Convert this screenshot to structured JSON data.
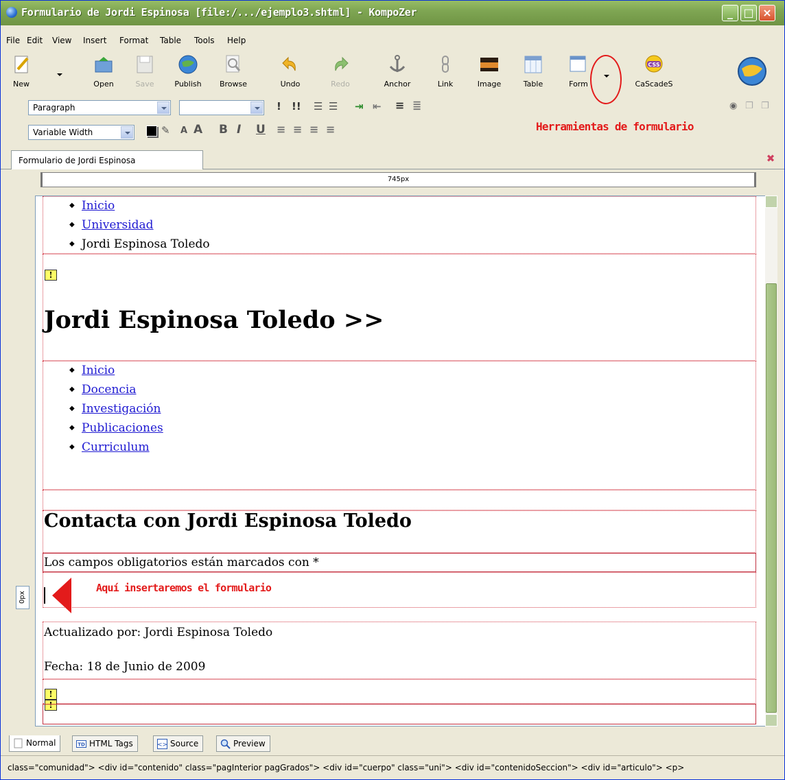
{
  "window": {
    "title": "Formulario de Jordi Espinosa [file:/.../ejemplo3.shtml] - KompoZer"
  },
  "menu": [
    "File",
    "Edit",
    "View",
    "Insert",
    "Format",
    "Table",
    "Tools",
    "Help"
  ],
  "toolbar": {
    "new": "New",
    "open": "Open",
    "save": "Save",
    "publish": "Publish",
    "browse": "Browse",
    "undo": "Undo",
    "redo": "Redo",
    "anchor": "Anchor",
    "link": "Link",
    "image": "Image",
    "table": "Table",
    "form": "Form",
    "cascades": "CaScadeS"
  },
  "format_bar": {
    "paragraph_value": "Paragraph",
    "font_value": "Variable Width"
  },
  "annotations": {
    "form_tools": "Herramientas de formulario",
    "insert_here": "Aquí insertaremos el formulario"
  },
  "doc_tab": {
    "label": "Formulario de Jordi Espinosa"
  },
  "ruler": {
    "width_label": "745px"
  },
  "side_label": "0px",
  "page": {
    "breadcrumb": [
      {
        "text": "Inicio",
        "link": true
      },
      {
        "text": "Universidad",
        "link": true
      },
      {
        "text": "Jordi Espinosa Toledo",
        "link": false
      }
    ],
    "heading": "Jordi Espinosa Toledo >>",
    "nav": [
      "Inicio",
      "Docencia",
      "Investigación",
      "Publicaciones",
      "Curriculum"
    ],
    "contact_heading": "Contacta con Jordi Espinosa Toledo",
    "required_note": "Los campos obligatorios están marcados con *",
    "updated_by": "Actualizado por: Jordi Espinosa Toledo",
    "date": "Fecha: 18 de Junio de 2009",
    "warn_glyph": "!"
  },
  "bottom_tabs": {
    "normal": "Normal",
    "html_tags": "HTML Tags",
    "source": "Source",
    "preview": "Preview"
  },
  "status_path": "class=\"comunidad\">  <div id=\"contenido\" class=\"pagInterior pagGrados\">  <div id=\"cuerpo\" class=\"uni\">  <div id=\"contenidoSeccion\">  <div id=\"articulo\">  <p>"
}
